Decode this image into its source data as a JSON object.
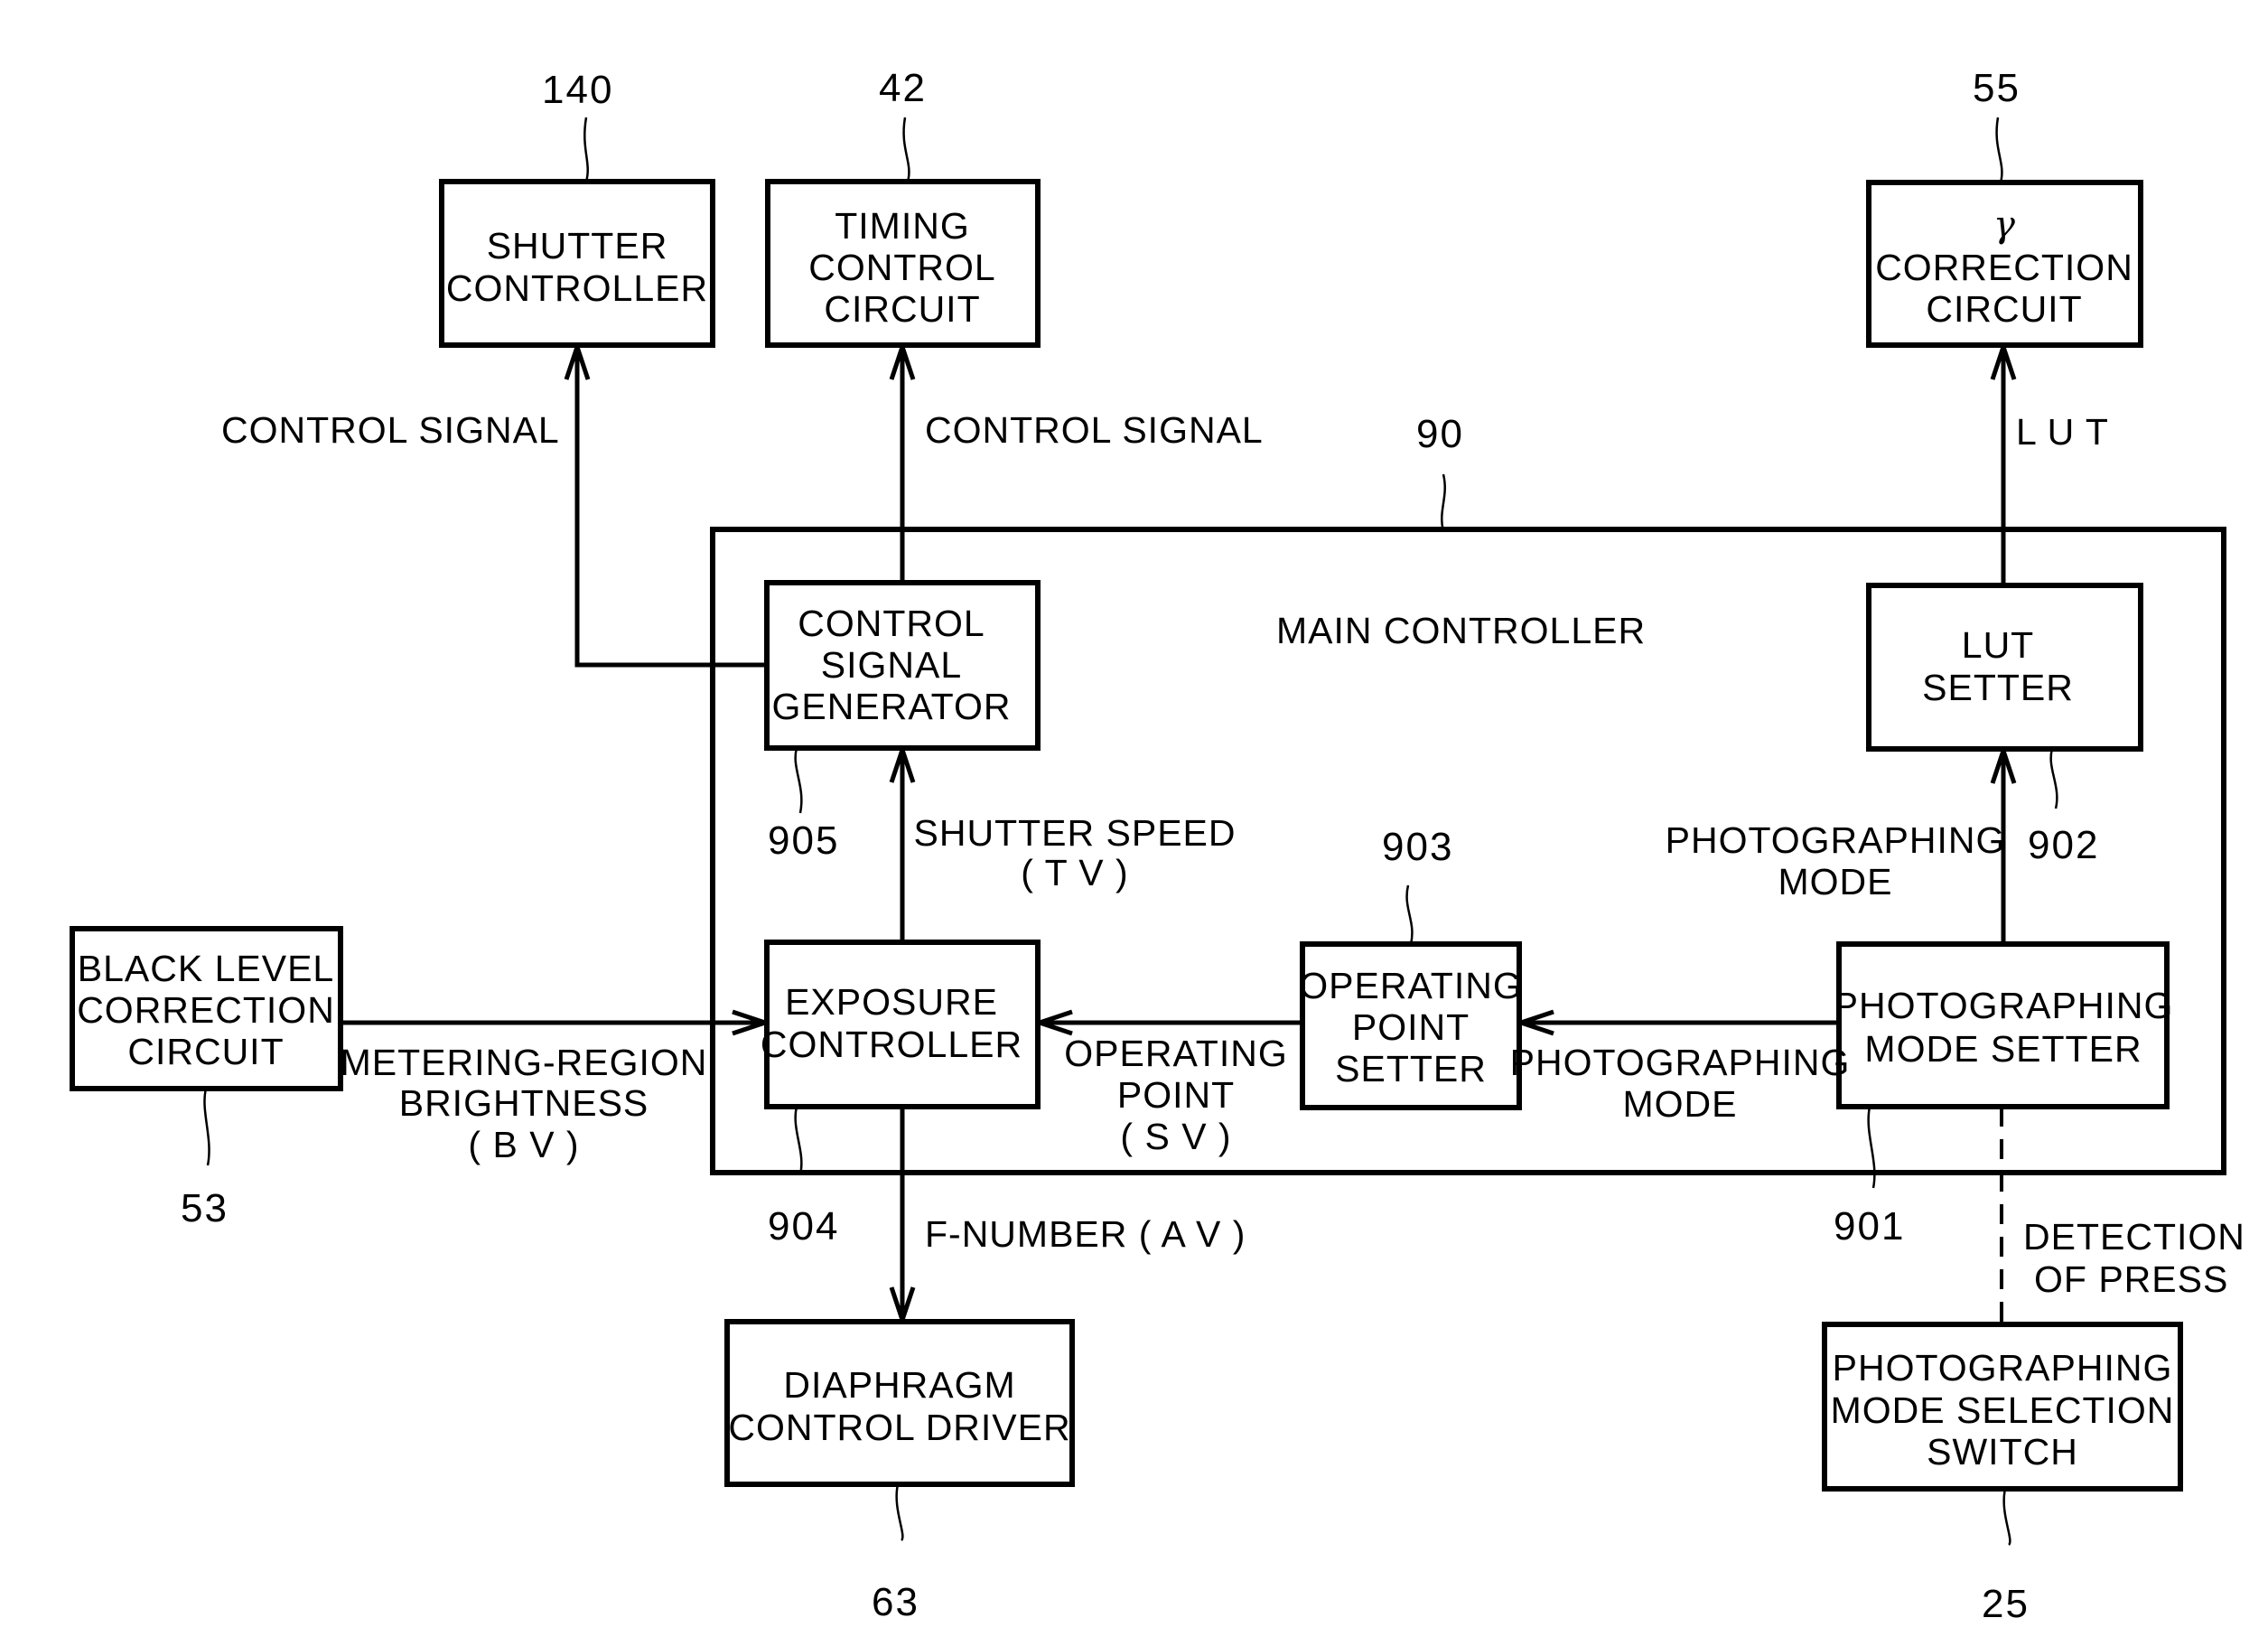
{
  "figure": {
    "container": {
      "ref": "90",
      "label": "MAIN CONTROLLER"
    },
    "blocks": {
      "shutter_controller": {
        "ref": "140",
        "lines": [
          "SHUTTER",
          "CONTROLLER"
        ]
      },
      "timing_control_circuit": {
        "ref": "42",
        "lines": [
          "TIMING",
          "CONTROL",
          "CIRCUIT"
        ]
      },
      "gamma_correction_circuit": {
        "ref": "55",
        "symbol": "γ",
        "lines": [
          "CORRECTION",
          "CIRCUIT"
        ]
      },
      "control_signal_generator": {
        "ref": "905",
        "lines": [
          "CONTROL",
          "SIGNAL",
          "GENERATOR"
        ]
      },
      "lut_setter": {
        "ref": "902",
        "lines": [
          "LUT",
          "SETTER"
        ]
      },
      "exposure_controller": {
        "ref": "904",
        "lines": [
          "EXPOSURE",
          "CONTROLLER"
        ]
      },
      "operating_point_setter": {
        "ref": "903",
        "lines": [
          "OPERATING",
          "POINT",
          "SETTER"
        ]
      },
      "photographing_mode_setter": {
        "ref": "901",
        "lines": [
          "PHOTOGRAPHING",
          "MODE  SETTER"
        ]
      },
      "black_level_correction_circuit": {
        "ref": "53",
        "lines": [
          "BLACK  LEVEL",
          "CORRECTION",
          "CIRCUIT"
        ]
      },
      "diaphragm_control_driver": {
        "ref": "63",
        "lines": [
          "DIAPHRAGM",
          "CONTROL  DRIVER"
        ]
      },
      "mode_selection_switch": {
        "ref": "25",
        "lines": [
          "PHOTOGRAPHING",
          "MODE  SELECTION",
          "SWITCH"
        ]
      }
    },
    "signals": {
      "control_signal_shutter": [
        "CONTROL  SIGNAL"
      ],
      "control_signal_timing": [
        "CONTROL  SIGNAL"
      ],
      "lut": [
        "L U T"
      ],
      "shutter_speed": [
        "SHUTTER  SPEED",
        "( T V )"
      ],
      "photographing_mode_up": [
        "PHOTOGRAPHING",
        "MODE"
      ],
      "metering_brightness": [
        "METERING-REGION",
        "BRIGHTNESS",
        "( B V )"
      ],
      "operating_point": [
        "OPERATING",
        "POINT",
        "( S V )"
      ],
      "photographing_mode_left": [
        "PHOTOGRAPHING",
        "MODE"
      ],
      "f_number": [
        "F-NUMBER ( A V )"
      ],
      "detection_of_press": [
        "DETECTION",
        "OF  PRESS"
      ]
    }
  }
}
